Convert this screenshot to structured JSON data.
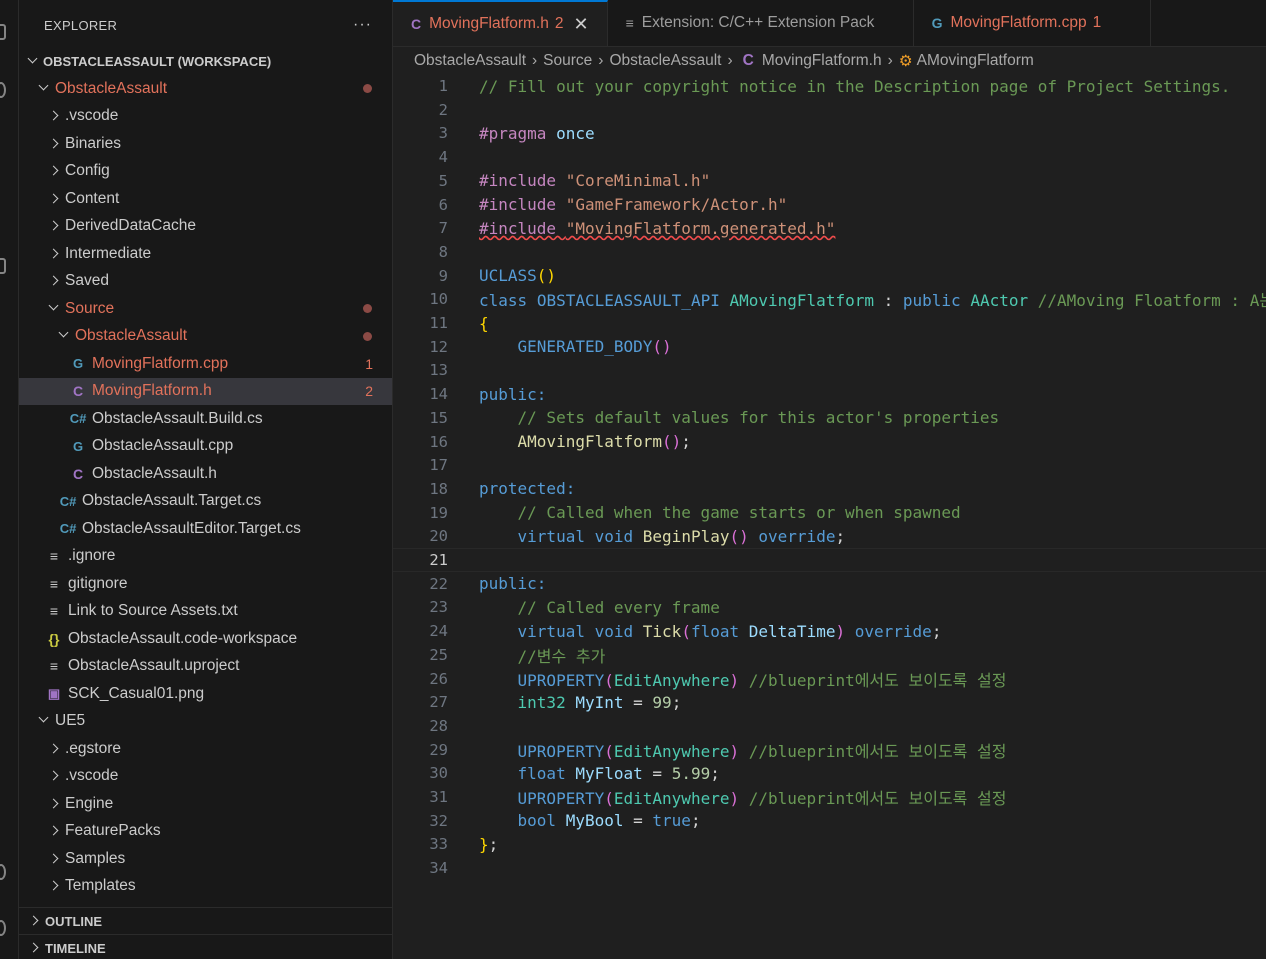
{
  "sidebar": {
    "title": "EXPLORER",
    "more": "···",
    "workspace": "OBSTACLEASSAULT (WORKSPACE)",
    "tree": [
      {
        "label": "ObstacleAssault",
        "indent": 1,
        "chev": "open",
        "modified": true,
        "dot": true
      },
      {
        "label": ".vscode",
        "indent": 2,
        "chev": "closed"
      },
      {
        "label": "Binaries",
        "indent": 2,
        "chev": "closed"
      },
      {
        "label": "Config",
        "indent": 2,
        "chev": "closed"
      },
      {
        "label": "Content",
        "indent": 2,
        "chev": "closed"
      },
      {
        "label": "DerivedDataCache",
        "indent": 2,
        "chev": "closed"
      },
      {
        "label": "Intermediate",
        "indent": 2,
        "chev": "closed"
      },
      {
        "label": "Saved",
        "indent": 2,
        "chev": "closed"
      },
      {
        "label": "Source",
        "indent": 2,
        "chev": "open",
        "modified": true,
        "dot": true
      },
      {
        "label": "ObstacleAssault",
        "indent": 3,
        "chev": "open",
        "modified": true,
        "dot": true
      },
      {
        "label": "MovingFlatform.cpp",
        "indent": 4,
        "icon": "cpp",
        "modified": true,
        "badge": "1"
      },
      {
        "label": "MovingFlatform.h",
        "indent": 4,
        "icon": "h",
        "modified": true,
        "badge": "2",
        "selected": true
      },
      {
        "label": "ObstacleAssault.Build.cs",
        "indent": 4,
        "icon": "cs"
      },
      {
        "label": "ObstacleAssault.cpp",
        "indent": 4,
        "icon": "cpp"
      },
      {
        "label": "ObstacleAssault.h",
        "indent": 4,
        "icon": "h"
      },
      {
        "label": "ObstacleAssault.Target.cs",
        "indent": 3,
        "icon": "cs"
      },
      {
        "label": "ObstacleAssaultEditor.Target.cs",
        "indent": 3,
        "icon": "cs"
      },
      {
        "label": ".ignore",
        "indent": 2,
        "icon": "txt"
      },
      {
        "label": "gitignore",
        "indent": 2,
        "icon": "txt"
      },
      {
        "label": "Link to Source Assets.txt",
        "indent": 2,
        "icon": "txt"
      },
      {
        "label": "ObstacleAssault.code-workspace",
        "indent": 2,
        "icon": "json"
      },
      {
        "label": "ObstacleAssault.uproject",
        "indent": 2,
        "icon": "txt"
      },
      {
        "label": "SCK_Casual01.png",
        "indent": 2,
        "icon": "png"
      },
      {
        "label": "UE5",
        "indent": 1,
        "chev": "open"
      },
      {
        "label": ".egstore",
        "indent": 2,
        "chev": "closed"
      },
      {
        "label": ".vscode",
        "indent": 2,
        "chev": "closed"
      },
      {
        "label": "Engine",
        "indent": 2,
        "chev": "closed"
      },
      {
        "label": "FeaturePacks",
        "indent": 2,
        "chev": "closed"
      },
      {
        "label": "Samples",
        "indent": 2,
        "chev": "closed"
      },
      {
        "label": "Templates",
        "indent": 2,
        "chev": "closed"
      }
    ],
    "outline": "OUTLINE",
    "timeline": "TIMELINE"
  },
  "tabs": [
    {
      "label": "MovingFlatform.h",
      "badge": "2",
      "icon": "C",
      "active": true,
      "close": "✕"
    },
    {
      "label": "Extension: C/C++ Extension Pack",
      "icon": "≡"
    },
    {
      "label": "MovingFlatform.cpp",
      "badge": "1",
      "icon": "G"
    }
  ],
  "breadcrumb": [
    "ObstacleAssault",
    "Source",
    "ObstacleAssault",
    "MovingFlatform.h",
    "AMovingFlatform"
  ],
  "breadcrumb_icons": {
    "file": "C",
    "class": "⚙"
  },
  "code": {
    "current_line": 21,
    "lines": [
      [
        [
          "// Fill out your copyright notice in the Description page of Project Settings.",
          "comment"
        ]
      ],
      [],
      [
        [
          "#pragma",
          "pp"
        ],
        [
          " ",
          "txt"
        ],
        [
          "once",
          "var"
        ]
      ],
      [],
      [
        [
          "#include",
          "pp"
        ],
        [
          " ",
          "txt"
        ],
        [
          "\"CoreMinimal.h\"",
          "str"
        ]
      ],
      [
        [
          "#include",
          "pp"
        ],
        [
          " ",
          "txt"
        ],
        [
          "\"GameFramework/Actor.h\"",
          "str"
        ]
      ],
      [
        [
          "#include \"MovingFlatform.generated.h\"",
          "squig"
        ]
      ],
      [],
      [
        [
          "UCLASS",
          "macro"
        ],
        [
          "()",
          "brace"
        ]
      ],
      [
        [
          "class",
          "kw"
        ],
        [
          " ",
          "txt"
        ],
        [
          "OBSTACLEASSAULT_API",
          "macro"
        ],
        [
          " ",
          "txt"
        ],
        [
          "AMovingFlatform",
          "type"
        ],
        [
          " : ",
          "txt"
        ],
        [
          "public",
          "kw"
        ],
        [
          " ",
          "txt"
        ],
        [
          "AActor",
          "type"
        ],
        [
          " ",
          "txt"
        ],
        [
          "//AMoving Floatform : A는",
          "comment"
        ]
      ],
      [
        [
          "{",
          "brace"
        ]
      ],
      [
        [
          "    ",
          "txt"
        ],
        [
          "GENERATED_BODY",
          "macro"
        ],
        [
          "()",
          "paren"
        ]
      ],
      [],
      [
        [
          "public:",
          "kw"
        ]
      ],
      [
        [
          "    ",
          "txt"
        ],
        [
          "// Sets default values for this actor's properties",
          "comment"
        ]
      ],
      [
        [
          "    ",
          "txt"
        ],
        [
          "AMovingFlatform",
          "fn"
        ],
        [
          "()",
          "paren"
        ],
        [
          ";",
          "txt"
        ]
      ],
      [],
      [
        [
          "protected:",
          "kw"
        ]
      ],
      [
        [
          "    ",
          "txt"
        ],
        [
          "// Called when the game starts or when spawned",
          "comment"
        ]
      ],
      [
        [
          "    ",
          "txt"
        ],
        [
          "virtual",
          "kw"
        ],
        [
          " ",
          "txt"
        ],
        [
          "void",
          "kw"
        ],
        [
          " ",
          "txt"
        ],
        [
          "BeginPlay",
          "fn"
        ],
        [
          "()",
          "paren"
        ],
        [
          " ",
          "txt"
        ],
        [
          "override",
          "kw"
        ],
        [
          ";",
          "txt"
        ]
      ],
      [],
      [
        [
          "public:",
          "kw"
        ]
      ],
      [
        [
          "    ",
          "txt"
        ],
        [
          "// Called every frame",
          "comment"
        ]
      ],
      [
        [
          "    ",
          "txt"
        ],
        [
          "virtual",
          "kw"
        ],
        [
          " ",
          "txt"
        ],
        [
          "void",
          "kw"
        ],
        [
          " ",
          "txt"
        ],
        [
          "Tick",
          "fn"
        ],
        [
          "(",
          "paren"
        ],
        [
          "float",
          "kw"
        ],
        [
          " ",
          "txt"
        ],
        [
          "DeltaTime",
          "var"
        ],
        [
          ")",
          "paren"
        ],
        [
          " ",
          "txt"
        ],
        [
          "override",
          "kw"
        ],
        [
          ";",
          "txt"
        ]
      ],
      [
        [
          "    ",
          "txt"
        ],
        [
          "//변수 추가",
          "comment"
        ]
      ],
      [
        [
          "    ",
          "txt"
        ],
        [
          "UPROPERTY",
          "macro"
        ],
        [
          "(",
          "paren"
        ],
        [
          "EditAnywhere",
          "type"
        ],
        [
          ")",
          "paren"
        ],
        [
          " ",
          "txt"
        ],
        [
          "//blueprint에서도 보이도록 설정",
          "comment"
        ]
      ],
      [
        [
          "    ",
          "txt"
        ],
        [
          "int32",
          "type"
        ],
        [
          " ",
          "txt"
        ],
        [
          "MyInt",
          "var"
        ],
        [
          " = ",
          "txt"
        ],
        [
          "99",
          "num"
        ],
        [
          ";",
          "txt"
        ]
      ],
      [],
      [
        [
          "    ",
          "txt"
        ],
        [
          "UPROPERTY",
          "macro"
        ],
        [
          "(",
          "paren"
        ],
        [
          "EditAnywhere",
          "type"
        ],
        [
          ")",
          "paren"
        ],
        [
          " ",
          "txt"
        ],
        [
          "//blueprint에서도 보이도록 설정",
          "comment"
        ]
      ],
      [
        [
          "    ",
          "txt"
        ],
        [
          "float",
          "kw"
        ],
        [
          " ",
          "txt"
        ],
        [
          "MyFloat",
          "var"
        ],
        [
          " = ",
          "txt"
        ],
        [
          "5.99",
          "num"
        ],
        [
          ";",
          "txt"
        ]
      ],
      [
        [
          "    ",
          "txt"
        ],
        [
          "UPROPERTY",
          "macro"
        ],
        [
          "(",
          "paren"
        ],
        [
          "EditAnywhere",
          "type"
        ],
        [
          ")",
          "paren"
        ],
        [
          " ",
          "txt"
        ],
        [
          "//blueprint에서도 보이도록 설정",
          "comment"
        ]
      ],
      [
        [
          "    ",
          "txt"
        ],
        [
          "bool",
          "kw"
        ],
        [
          " ",
          "txt"
        ],
        [
          "MyBool",
          "var"
        ],
        [
          " = ",
          "txt"
        ],
        [
          "true",
          "kw"
        ],
        [
          ";",
          "txt"
        ]
      ],
      [
        [
          "}",
          "brace"
        ],
        [
          ";",
          "txt"
        ]
      ],
      []
    ]
  },
  "colors": {
    "accent": "#0078d4",
    "modified": "#e2725b",
    "comment": "#6a9955",
    "keyword": "#569cd6"
  }
}
